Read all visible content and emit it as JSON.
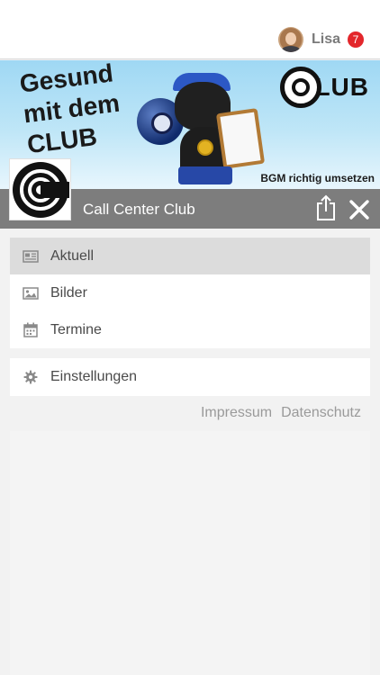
{
  "user": {
    "name": "Lisa",
    "notification_count": "7"
  },
  "banner": {
    "headline": [
      "Gesund",
      "mit dem",
      "CLUB"
    ],
    "logo_text": "LUB",
    "slogan": "BGM richtig umsetzen"
  },
  "club": {
    "name": "Call Center Club",
    "icons": {
      "share": "share-icon",
      "close": "close-icon",
      "logo": "club-logo"
    }
  },
  "menu": {
    "items": [
      {
        "label": "Aktuell",
        "icon": "newspaper-icon",
        "active": true
      },
      {
        "label": "Bilder",
        "icon": "image-icon",
        "active": false
      },
      {
        "label": "Termine",
        "icon": "calendar-icon",
        "active": false
      }
    ],
    "settings": {
      "label": "Einstellungen",
      "icon": "gear-icon"
    }
  },
  "footer": {
    "impressum": "Impressum",
    "datenschutz": "Datenschutz"
  },
  "colors": {
    "badge": "#e3262b",
    "bar": "#7d7d7d",
    "active_item": "#dcdcdc"
  }
}
